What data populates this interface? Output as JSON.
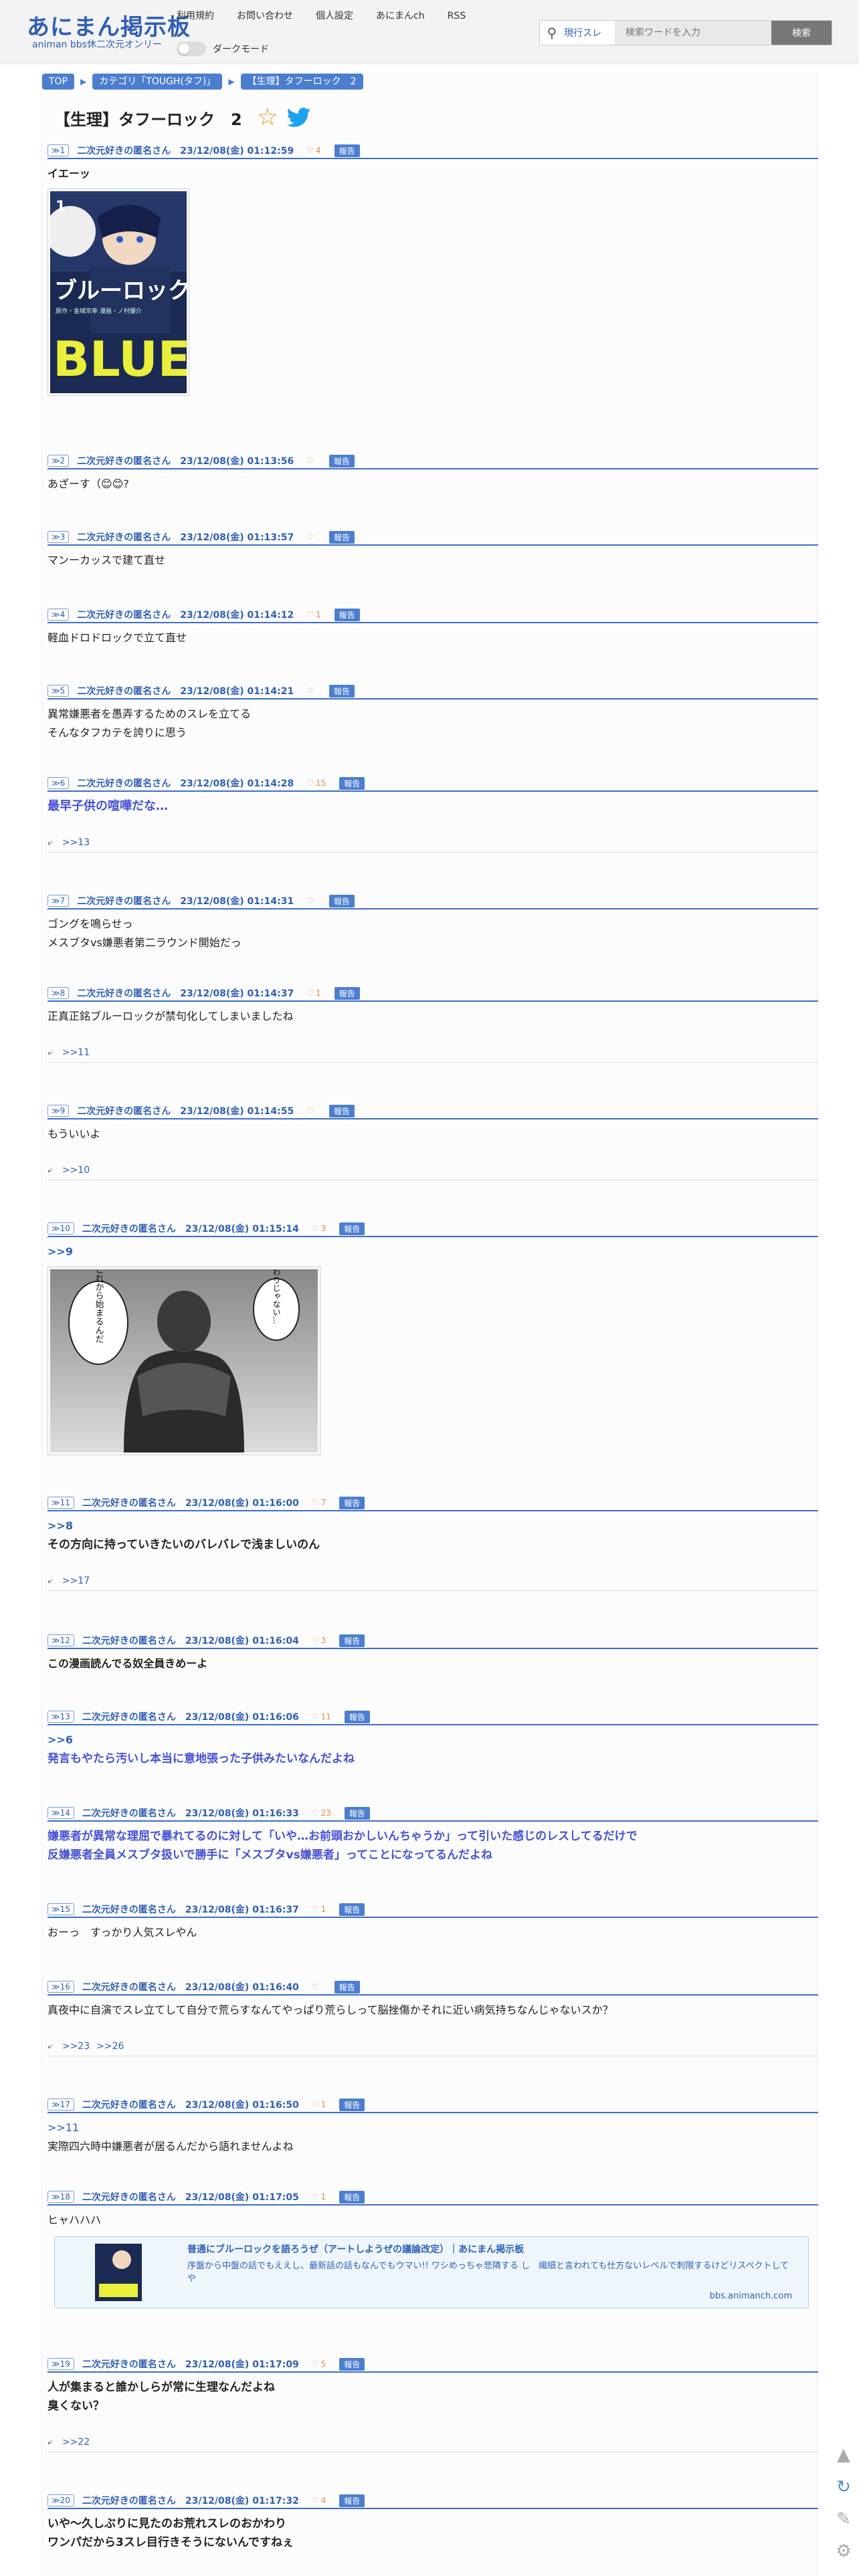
{
  "site": {
    "logo": "あにまん掲示板",
    "tagline": "animan bbs休二次元オンリー"
  },
  "nav": [
    "利用規約",
    "お問い合わせ",
    "個人設定",
    "あにまんch",
    "RSS"
  ],
  "dark_mode": {
    "label": "ダークモード",
    "on": false
  },
  "search": {
    "scope": "現行スレ",
    "placeholder": "検索ワードを入力",
    "button": "検索"
  },
  "breadcrumbs": [
    "TOP",
    "カテゴリ「TOUGH(タフ)」",
    "【生理】タフーロック　2"
  ],
  "thread": {
    "title": "【生理】タフーロック　2"
  },
  "posts": [
    {
      "num": "1",
      "name": "二次元好きの匿名さん",
      "date": "23/12/08(金) 01:12:59",
      "likes": "4",
      "report": "報告",
      "lines": [
        "イエーッ"
      ]
    },
    {
      "num": "2",
      "name": "二次元好きの匿名さん",
      "date": "23/12/08(金) 01:13:56",
      "likes": "",
      "report": "報告",
      "lines": [
        "あざーす（😊😊?"
      ]
    },
    {
      "num": "3",
      "name": "二次元好きの匿名さん",
      "date": "23/12/08(金) 01:13:57",
      "likes": "",
      "report": "報告",
      "lines": [
        "マンーカッスで建て直せ"
      ]
    },
    {
      "num": "4",
      "name": "二次元好きの匿名さん",
      "date": "23/12/08(金) 01:14:12",
      "likes": "1",
      "report": "報告",
      "lines": [
        "軽血ドロドロックで立て直せ"
      ]
    },
    {
      "num": "5",
      "name": "二次元好きの匿名さん",
      "date": "23/12/08(金) 01:14:21",
      "likes": "",
      "report": "報告",
      "lines": [
        "異常嫌悪者を愚弄するためのスレを立てる",
        "そんなタフカテを誇りに思う"
      ]
    },
    {
      "num": "6",
      "name": "二次元好きの匿名さん",
      "date": "23/12/08(金) 01:14:28",
      "likes": "15",
      "report": "報告",
      "lines": [
        "最早子供の喧嘩だな…"
      ],
      "replies": [
        ">>13"
      ]
    },
    {
      "num": "7",
      "name": "二次元好きの匿名さん",
      "date": "23/12/08(金) 01:14:31",
      "likes": "",
      "report": "報告",
      "lines": [
        "ゴングを鳴らせっ",
        "メスブタvs嫌悪者第二ラウンド開始だっ"
      ]
    },
    {
      "num": "8",
      "name": "二次元好きの匿名さん",
      "date": "23/12/08(金) 01:14:37",
      "likes": "1",
      "report": "報告",
      "lines": [
        "正真正銘ブルーロックが禁句化してしまいましたね"
      ],
      "replies": [
        ">>11"
      ]
    },
    {
      "num": "9",
      "name": "二次元好きの匿名さん",
      "date": "23/12/08(金) 01:14:55",
      "likes": "",
      "report": "報告",
      "lines": [
        "もういいよ"
      ],
      "replies": [
        ">>10"
      ]
    },
    {
      "num": "10",
      "name": "二次元好きの匿名さん",
      "date": "23/12/08(金) 01:15:14",
      "likes": "3",
      "report": "報告",
      "anchor": ">>9",
      "manga_text": [
        "これから始まるんだ",
        "終わりじゃない…"
      ]
    },
    {
      "num": "11",
      "name": "二次元好きの匿名さん",
      "date": "23/12/08(金) 01:16:00",
      "likes": "7",
      "report": "報告",
      "anchor": ">>8",
      "lines": [
        "その方向に持っていきたいのバレバレで浅ましいのん"
      ],
      "replies": [
        ">>17"
      ]
    },
    {
      "num": "12",
      "name": "二次元好きの匿名さん",
      "date": "23/12/08(金) 01:16:04",
      "likes": "3",
      "report": "報告",
      "lines": [
        "この漫画読んでる奴全員きめーよ"
      ]
    },
    {
      "num": "13",
      "name": "二次元好きの匿名さん",
      "date": "23/12/08(金) 01:16:06",
      "likes": "11",
      "report": "報告",
      "anchor": ">>6",
      "lines": [
        "発言もやたら汚いし本当に意地張った子供みたいなんだよね"
      ]
    },
    {
      "num": "14",
      "name": "二次元好きの匿名さん",
      "date": "23/12/08(金) 01:16:33",
      "likes": "23",
      "report": "報告",
      "lines": [
        "嫌悪者が異常な理屈で暴れてるのに対して「いや…お前頭おかしいんちゃうか」って引いた感じのレスしてるだけで",
        "反嫌悪者全員メスブタ扱いで勝手に「メスブタvs嫌悪者」ってことになってるんだよね"
      ]
    },
    {
      "num": "15",
      "name": "二次元好きの匿名さん",
      "date": "23/12/08(金) 01:16:37",
      "likes": "1",
      "report": "報告",
      "lines": [
        "おーっ　すっかり人気スレやん"
      ]
    },
    {
      "num": "16",
      "name": "二次元好きの匿名さん",
      "date": "23/12/08(金) 01:16:40",
      "likes": "",
      "report": "報告",
      "lines": [
        "真夜中に自演でスレ立てして自分で荒らすなんてやっぱり荒らしって脳挫傷かそれに近い病気持ちなんじゃないスか？"
      ],
      "replies": [
        ">>23",
        ">>26"
      ]
    },
    {
      "num": "17",
      "name": "二次元好きの匿名さん",
      "date": "23/12/08(金) 01:16:50",
      "likes": "1",
      "report": "報告",
      "anchor": ">>11",
      "lines": [
        "実際四六時中嫌悪者が居るんだから語れませんよね"
      ]
    },
    {
      "num": "18",
      "name": "二次元好きの匿名さん",
      "date": "23/12/08(金) 01:17:05",
      "likes": "1",
      "report": "報告",
      "lines": [
        "ヒャハハハ"
      ],
      "card": {
        "title": "普通にブルーロックを語ろうぜ（アートしようぜの議論改定）｜あにまん掲示板",
        "desc": "序盤から中盤の話でもええし、最新話の話もなんでもウマい!! ワシめっちゃ悲隣する し　繊細と言われても仕方ないレベルで刺限するけどリスペクトしてや",
        "domain": "bbs.animanch.com"
      }
    },
    {
      "num": "19",
      "name": "二次元好きの匿名さん",
      "date": "23/12/08(金) 01:17:09",
      "likes": "5",
      "report": "報告",
      "lines": [
        "人が集まると誰かしらが常に生理なんだよね",
        "臭くない？"
      ],
      "replies": [
        ">>22"
      ]
    },
    {
      "num": "20",
      "name": "二次元好きの匿名さん",
      "date": "23/12/08(金) 01:17:32",
      "likes": "4",
      "report": "報告",
      "lines": [
        "いや～久しぶりに見たのお荒れスレのおかわり",
        "ワンパだから3スレ目行きそうにないんですねぇ"
      ]
    }
  ],
  "cover_text": {
    "vol": "1",
    "title": "ブルーロック",
    "en": "BLUE",
    "sub": "原作・金城宗幸 漫画・ノ村優介"
  },
  "colors": {
    "accent": "#4c7ed0",
    "link": "#2f5fb5",
    "highlight": "#4450d6",
    "like": "#e88a3a"
  }
}
